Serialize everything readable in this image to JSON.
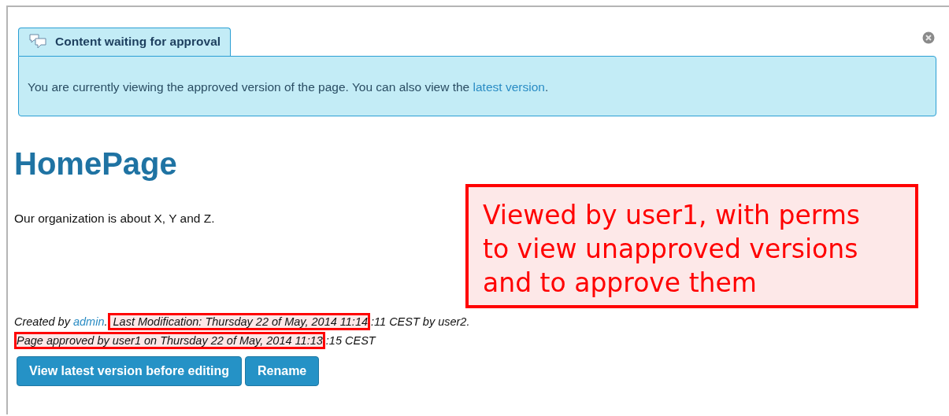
{
  "notice": {
    "tab_title": "Content waiting for approval",
    "message_parts": [
      {
        "kind": "plain",
        "text": "You are currently viewing the approved version of the page. You can also view the "
      },
      {
        "kind": "link",
        "text": "latest version"
      },
      {
        "kind": "plain",
        "text": "."
      }
    ]
  },
  "page": {
    "title": "HomePage",
    "body": "Our organization is about X, Y and Z."
  },
  "annotation": {
    "text": "Viewed by user1, with perms to view unapproved versions and to approve them"
  },
  "meta_lines": [
    {
      "parts": [
        {
          "kind": "plain",
          "text": "Created by "
        },
        {
          "kind": "link",
          "text": "admin"
        },
        {
          "kind": "plain",
          "text": "."
        },
        {
          "kind": "highlight",
          "text": " Last Modification: Thursday 22 of May, 2014 11:14"
        },
        {
          "kind": "plain",
          "text": ":11 CEST by user2."
        }
      ]
    },
    {
      "parts": [
        {
          "kind": "highlight",
          "text": "Page approved by user1 on Thursday 22 of May, 2014 11:13"
        },
        {
          "kind": "plain",
          "text": ":15 CEST"
        }
      ]
    }
  ],
  "buttons": [
    "View latest version before editing",
    "Rename"
  ]
}
